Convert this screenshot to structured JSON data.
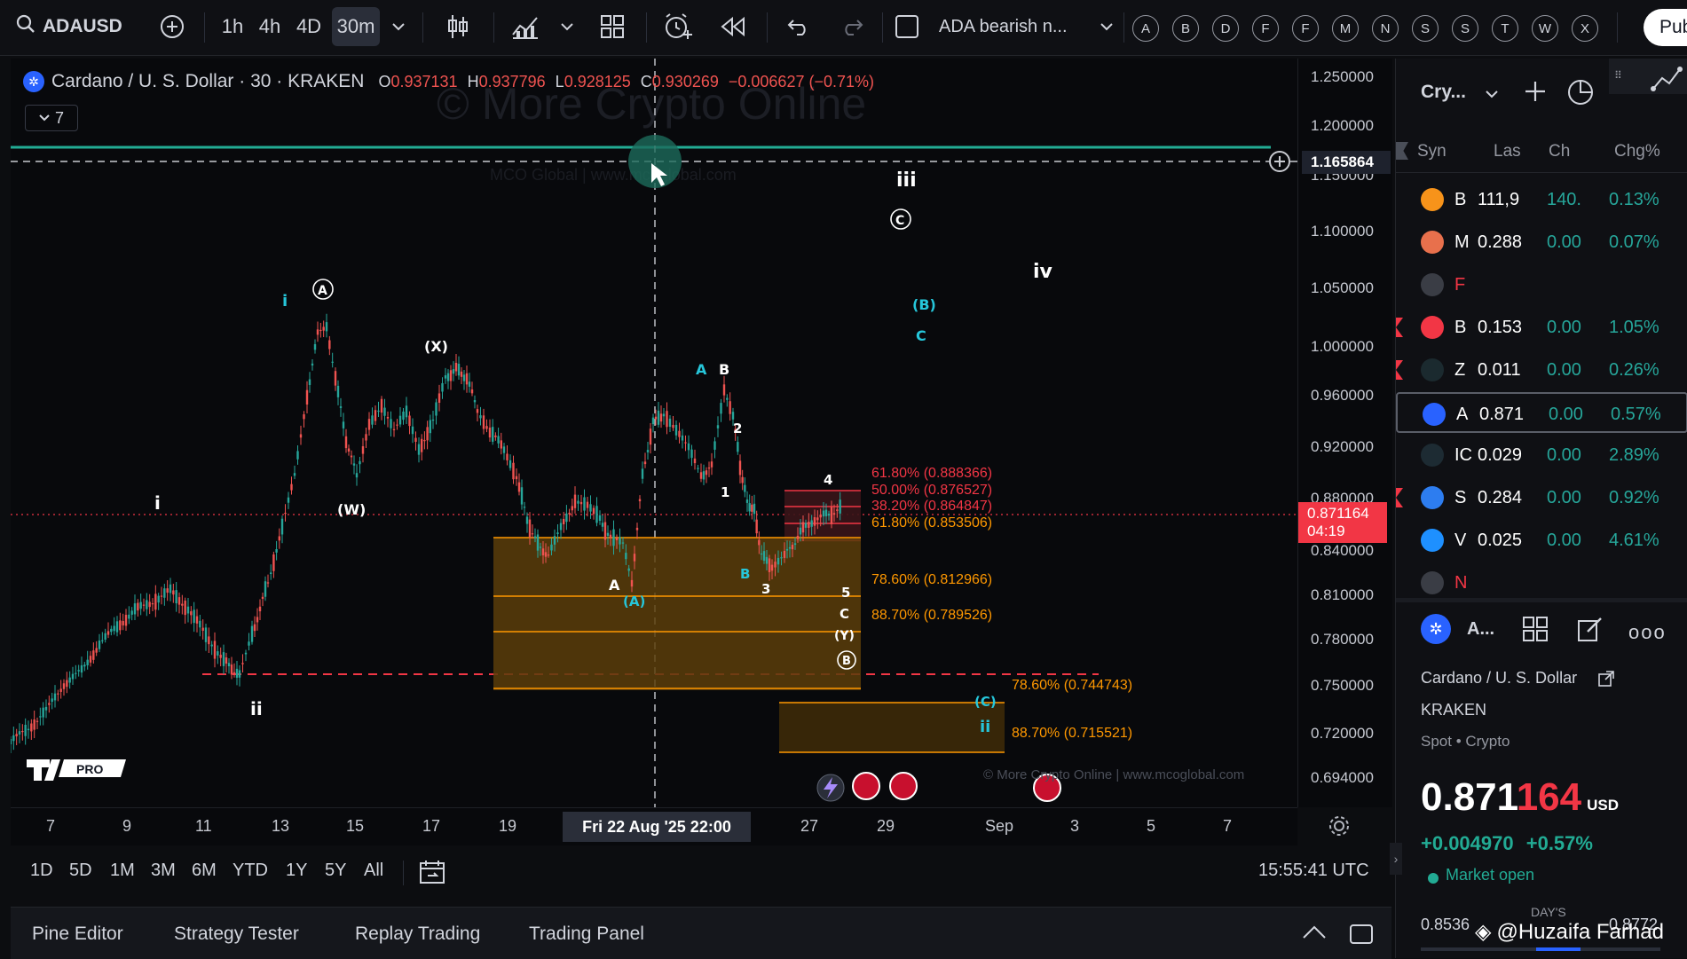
{
  "symbol": "ADAUSD",
  "toolbar": {
    "intervals": [
      "1h",
      "4h",
      "4D",
      "30m"
    ],
    "active_interval": "30m",
    "layout_name": "ADA bearish n...",
    "letters": [
      "A",
      "B",
      "D",
      "F",
      "F",
      "M",
      "N",
      "S",
      "S",
      "T",
      "W",
      "X"
    ],
    "publish_label": "Pub"
  },
  "legend": {
    "title": "Cardano / U. S. Dollar · 30 · KRAKEN",
    "o_label": "O",
    "o": "0.937131",
    "h_label": "H",
    "h": "0.937796",
    "l_label": "L",
    "l": "0.928125",
    "c_label": "C",
    "c": "0.930269",
    "change": "−0.006627 (−0.71%)",
    "indicators_count": "7"
  },
  "watermark": {
    "main": "© More Crypto Online",
    "sub": "MCO Global  |  www.mcoglobal.com",
    "bottom": "© More Crypto Online  |  www.mcoglobal.com"
  },
  "price_scale": [
    "1.250000",
    "1.200000",
    "1.150000",
    "1.100000",
    "1.050000",
    "1.000000",
    "0.960000",
    "0.920000",
    "0.880000",
    "0.840000",
    "0.810000",
    "0.780000",
    "0.750000",
    "0.720000",
    "0.694000"
  ],
  "crosshair_price": "1.165864",
  "last_price_tag": "0.871164",
  "countdown": "04:19",
  "time_axis": [
    "7",
    "9",
    "11",
    "13",
    "15",
    "17",
    "19",
    "27",
    "29",
    "Sep",
    "3",
    "5",
    "7"
  ],
  "crosshair_time": "Fri 22 Aug '25   22:00",
  "fib_labels": {
    "f618_top": "61.80% (0.888366)",
    "f500": "50.00% (0.876527)",
    "f382": "38.20% (0.864847)",
    "f618": "61.80% (0.853506)",
    "f786": "78.60% (0.812966)",
    "f887": "88.70% (0.789526)",
    "f786_low": "78.60% (0.744743)",
    "f887_low": "88.70% (0.715521)"
  },
  "wave_labels": {
    "i_top": "i",
    "A_circ": "A",
    "X": "(X)",
    "W": "(W)",
    "i_left": "i",
    "ii": "ii",
    "iii": "iii",
    "C_circ": "C",
    "iv": "iv",
    "B_paren": "(B)",
    "c_small": "C",
    "A_teal": "A",
    "B_white": "B",
    "two": "2",
    "one": "1",
    "four": "4",
    "A_white": "A",
    "A_paren": "(A)",
    "B_teal": "B",
    "three": "3",
    "five": "5",
    "C_white": "C",
    "Y": "(Y)",
    "B_circ": "B",
    "C_paren": "(C)",
    "ii_teal": "ii"
  },
  "range_buttons": [
    "1D",
    "5D",
    "1M",
    "3M",
    "6M",
    "YTD",
    "1Y",
    "5Y",
    "All"
  ],
  "clock": "15:55:41 UTC",
  "bottom_tabs": [
    "Pine Editor",
    "Strategy Tester",
    "Replay Trading",
    "Trading Panel"
  ],
  "watchlist": {
    "title": "Cry...",
    "headers": {
      "symbol": "Syn",
      "last": "Las",
      "change": "Ch",
      "change_pct": "Chg%"
    },
    "rows": [
      {
        "sym": "B",
        "last": "111,9",
        "ch": "140.",
        "pct": "0.13%",
        "color": "#f7931a",
        "flag": false
      },
      {
        "sym": "M",
        "last": "0.288",
        "ch": "0.00",
        "pct": "0.07%",
        "color": "#e8704c",
        "flag": false
      },
      {
        "sym": "F",
        "last": "",
        "ch": "",
        "pct": "",
        "color": "#3a3d45",
        "flag": false
      },
      {
        "sym": "B",
        "last": "0.153",
        "ch": "0.00",
        "pct": "1.05%",
        "color": "#f23645",
        "flag": true
      },
      {
        "sym": "Z",
        "last": "0.011",
        "ch": "0.00",
        "pct": "0.26%",
        "color": "#1b2a2f",
        "flag": true
      },
      {
        "sym": "A",
        "last": "0.871",
        "ch": "0.00",
        "pct": "0.57%",
        "color": "#2962ff",
        "flag": false
      },
      {
        "sym": "IC",
        "last": "0.029",
        "ch": "0.00",
        "pct": "2.89%",
        "color": "#1d2b33",
        "flag": false
      },
      {
        "sym": "S",
        "last": "0.284",
        "ch": "0.00",
        "pct": "0.92%",
        "color": "#2d7df0",
        "flag": true
      },
      {
        "sym": "V",
        "last": "0.025",
        "ch": "0.00",
        "pct": "4.61%",
        "color": "#1e90ff",
        "flag": false
      },
      {
        "sym": "N",
        "last": "",
        "ch": "",
        "pct": "",
        "color": "#3a3d45",
        "flag": false
      }
    ]
  },
  "details": {
    "short_name": "A...",
    "full_name": "Cardano / U. S. Dollar",
    "exchange": "KRAKEN",
    "type": "Spot • Crypto",
    "price_main": "0.871",
    "price_tail": "164",
    "currency": "USD",
    "change": "+0.004970",
    "change_pct": "+0.57%",
    "market_status": "Market open",
    "days_range_label": "DAY'S",
    "low": "0.8536",
    "high": "0.8772"
  },
  "overlay_credit": "@Huzaifa Farhad",
  "colors": {
    "bg": "#08090c",
    "up": "#26a69a",
    "down": "#ef5350",
    "fib_red": "#f23645",
    "fib_orange": "#ff9800",
    "accent_green": "#22ab94",
    "teal_label": "#26c6da"
  }
}
